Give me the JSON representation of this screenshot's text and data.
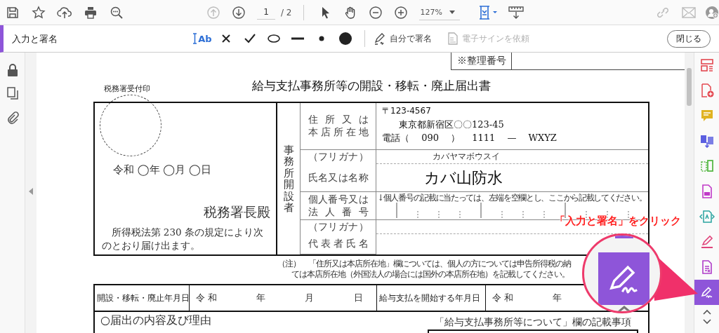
{
  "toolbar": {
    "prev_page": {
      "disabled": true
    },
    "page": {
      "value": "1",
      "total": "/ 2"
    },
    "zoom": {
      "value": "127%"
    },
    "share_link": {
      "disabled": true
    },
    "email": {
      "disabled": true
    }
  },
  "fill_sign_bar": {
    "title": "入力と署名",
    "tools": [
      {
        "kind": "text",
        "label": "Ab",
        "selected": true
      },
      {
        "kind": "cross",
        "selected": false
      },
      {
        "kind": "check",
        "selected": false
      },
      {
        "kind": "ellipse",
        "selected": false
      },
      {
        "kind": "line",
        "selected": false
      },
      {
        "kind": "dot",
        "selected": false
      },
      {
        "kind": "color",
        "selected": false
      }
    ],
    "sign_self": {
      "label": "自分で署名",
      "disabled": false
    },
    "request_esign": {
      "label": "電子サインを依頼",
      "disabled": true
    },
    "close_button": "閉じる"
  },
  "document": {
    "reference_label": "※整理番号",
    "stamp_label": "税務署受付印",
    "title": "給与支払事務所等の開設・移転・廃止届出書",
    "date_line": "令和 ◯年 ◯月 ◯日",
    "addressee": "税務署長殿",
    "declaration": "所得税法第 230 条の規定により次のとおり届け出ます。",
    "applicant_heading": "事務所開設者",
    "rows": [
      {
        "kind": "address",
        "label_lines": [
          "住所又は",
          "本店所在地"
        ],
        "lines": [
          "〒123-4567",
          "東京都新宿区〇〇123-45",
          "電話（　 090 　）　 1111 　—　 WXYZ"
        ]
      },
      {
        "kind": "furigana",
        "label_lines": [
          "（フリガナ）"
        ],
        "value": "カバヤマボウスイ"
      },
      {
        "kind": "name",
        "label_lines": [
          "氏名又は名称"
        ],
        "value": "カバ山防水"
      },
      {
        "kind": "number",
        "label_lines": [
          "個人番号又は",
          "法人番号"
        ],
        "note": "↓個人番号の記載に当たっては、左端を空欄とし、ここから記載してください。"
      },
      {
        "kind": "furigana",
        "label_lines": [
          "（フリガナ）"
        ]
      },
      {
        "kind": "name",
        "label_lines": [
          "代表者氏名"
        ]
      }
    ],
    "note_lines": [
      "（注）　「住所又は本店所在地」欄については、個人の方については申告所得税の納",
      "ては本店所在地（外国法人の場合には国外の本店所在地）を記載してください。"
    ],
    "date_row": [
      {
        "kind": "label",
        "text": "開設・移転・廃止年月日"
      },
      {
        "kind": "value",
        "text": "令 和　　　　 年　　　　 月　　　　 日"
      },
      {
        "kind": "label",
        "text": "給与支払を開始する年月日"
      },
      {
        "kind": "value",
        "text": "令 和　　　　 年"
      }
    ],
    "reason_heading": "○届出の内容及び理由",
    "details_heading": "「給与支払事務所等について」欄の記載事項"
  },
  "right_rail": {
    "tools": [
      {
        "kind": "layout",
        "selected": false
      },
      {
        "kind": "create",
        "selected": false
      },
      {
        "kind": "comment",
        "selected": false
      },
      {
        "kind": "export",
        "selected": false
      },
      {
        "kind": "organize",
        "selected": false
      },
      {
        "kind": "compress",
        "selected": false
      },
      {
        "kind": "scan",
        "selected": false
      },
      {
        "kind": "pen",
        "selected": false
      },
      {
        "kind": "form",
        "selected": false
      },
      {
        "kind": "sign",
        "selected": true
      }
    ]
  },
  "callout": {
    "text": "「入力と署名」をクリック"
  }
}
